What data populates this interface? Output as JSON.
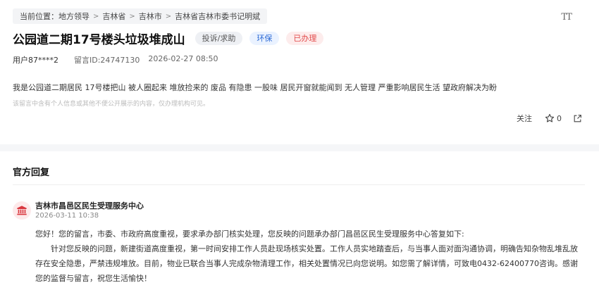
{
  "breadcrumb": {
    "prefix": "当前位置：",
    "items": [
      "地方领导",
      "吉林省",
      "吉林市",
      "吉林省吉林市委书记明斌"
    ]
  },
  "font_toggle": "TT",
  "post": {
    "title": "公园道二期17号楼头垃圾堆成山",
    "tags": [
      "投诉/求助",
      "环保",
      "已办理"
    ],
    "user": "用户87****2",
    "message_id": "留言ID:24747130",
    "time": "2026-02-27 08:50",
    "content": "我是公园道二期居民 17号楼把山 被人圈起来 堆放捡来的 废品  有隐患 一股味 居民开窗就能闻到 无人管理 严重影响居民生活 望政府解决为盼",
    "notice": "该留言中含有个人信息或其他不便公开展示的内容，仅办理机构可见。"
  },
  "actions": {
    "follow": "关注",
    "like_count": "0"
  },
  "reply_section": {
    "title": "官方回复",
    "org": "吉林市昌邑区民生受理服务中心",
    "time": "2026-03-11 10:38",
    "p1": "您好！您的留言，市委、市政府高度重视，要求承办部门核实处理，您反映的问题承办部门昌邑区民生受理服务中心答复如下:",
    "p2": "针对您反映的问题，新建街道高度重视，第一时间安排工作人员赴现场核实处置。工作人员实地踏查后，与当事人面对面沟通协调，明确告知杂物乱堆乱放存在安全隐患，严禁违规堆放。目前，物业已联合当事人完成杂物清理工作，相关处置情况已向您说明。如您需了解详情，可致电0432-62400770咨询。感谢您的监督与留言，祝您生活愉快！"
  },
  "colors": {
    "env_tag": "#2e6bd6",
    "done_tag": "#e24b4b",
    "avatar_bg": "#fde9ea",
    "avatar_icon": "#d9363e"
  }
}
